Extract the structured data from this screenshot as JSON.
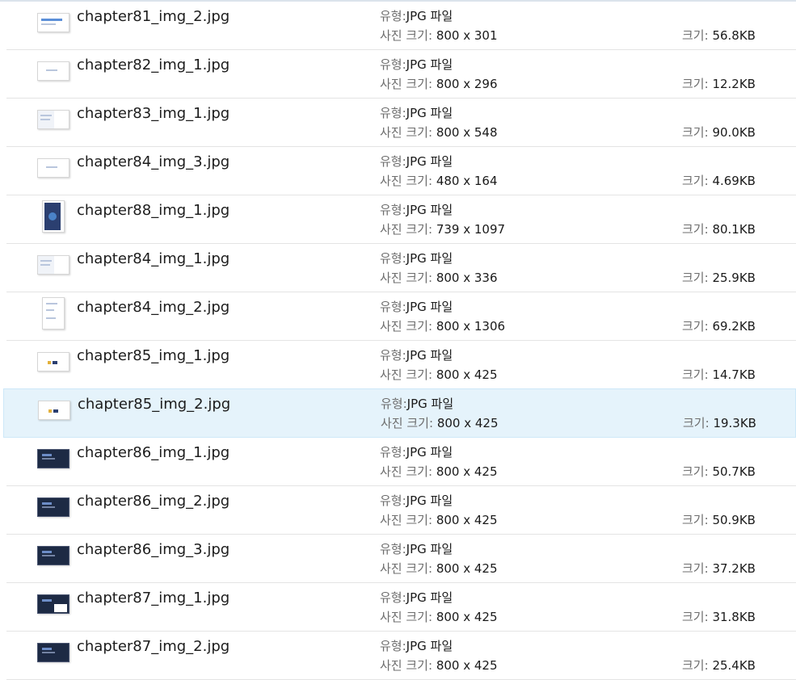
{
  "labels": {
    "type": "유형:",
    "dimensions": "사진 크기:",
    "size": "크기:"
  },
  "files": [
    {
      "name": "chapter81_img_2.jpg",
      "type": "JPG 파일",
      "dimensions": "800 x 301",
      "size": "56.8KB",
      "thumb": "wide-blue"
    },
    {
      "name": "chapter82_img_1.jpg",
      "type": "JPG 파일",
      "dimensions": "800 x 296",
      "size": "12.2KB",
      "thumb": "wide-light"
    },
    {
      "name": "chapter83_img_1.jpg",
      "type": "JPG 파일",
      "dimensions": "800 x 548",
      "size": "90.0KB",
      "thumb": "wide-doc"
    },
    {
      "name": "chapter84_img_3.jpg",
      "type": "JPG 파일",
      "dimensions": "480 x 164",
      "size": "4.69KB",
      "thumb": "wide-light"
    },
    {
      "name": "chapter88_img_1.jpg",
      "type": "JPG 파일",
      "dimensions": "739 x 1097",
      "size": "80.1KB",
      "thumb": "tall-dark"
    },
    {
      "name": "chapter84_img_1.jpg",
      "type": "JPG 파일",
      "dimensions": "800 x 336",
      "size": "25.9KB",
      "thumb": "wide-doc"
    },
    {
      "name": "chapter84_img_2.jpg",
      "type": "JPG 파일",
      "dimensions": "800 x 1306",
      "size": "69.2KB",
      "thumb": "tall-light"
    },
    {
      "name": "chapter85_img_1.jpg",
      "type": "JPG 파일",
      "dimensions": "800 x 425",
      "size": "14.7KB",
      "thumb": "wide-dot"
    },
    {
      "name": "chapter85_img_2.jpg",
      "type": "JPG 파일",
      "dimensions": "800 x 425",
      "size": "19.3KB",
      "thumb": "wide-dot",
      "selected": true
    },
    {
      "name": "chapter86_img_1.jpg",
      "type": "JPG 파일",
      "dimensions": "800 x 425",
      "size": "50.7KB",
      "thumb": "wide-dark"
    },
    {
      "name": "chapter86_img_2.jpg",
      "type": "JPG 파일",
      "dimensions": "800 x 425",
      "size": "50.9KB",
      "thumb": "wide-dark"
    },
    {
      "name": "chapter86_img_3.jpg",
      "type": "JPG 파일",
      "dimensions": "800 x 425",
      "size": "37.2KB",
      "thumb": "wide-dark"
    },
    {
      "name": "chapter87_img_1.jpg",
      "type": "JPG 파일",
      "dimensions": "800 x 425",
      "size": "31.8KB",
      "thumb": "wide-dark-split"
    },
    {
      "name": "chapter87_img_2.jpg",
      "type": "JPG 파일",
      "dimensions": "800 x 425",
      "size": "25.4KB",
      "thumb": "wide-dark"
    }
  ]
}
